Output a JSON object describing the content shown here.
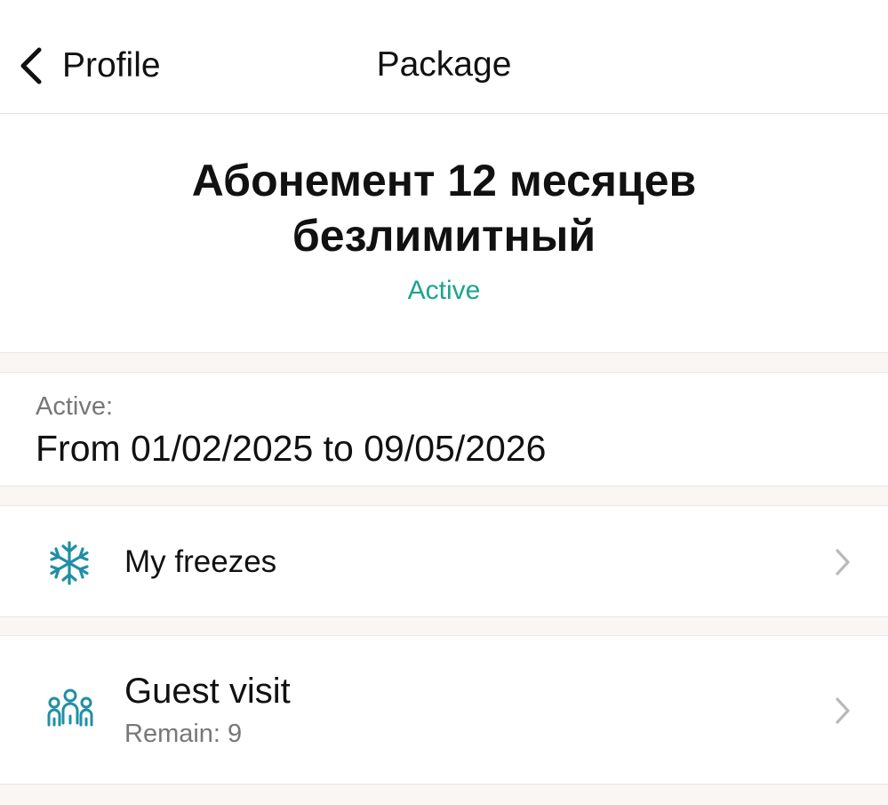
{
  "navbar": {
    "back_label": "Profile",
    "title": "Package"
  },
  "package": {
    "name": "Абонемент 12 месяцев безлимитный",
    "status": "Active"
  },
  "validity": {
    "label": "Active:",
    "range": "From 01/02/2025 to 09/05/2026"
  },
  "rows": {
    "freezes": {
      "icon": "snowflake-icon",
      "label": "My freezes"
    },
    "guest": {
      "icon": "people-group-icon",
      "label": "Guest visit",
      "sublabel": "Remain: 9"
    }
  },
  "colors": {
    "accent": "#1aa58c",
    "icon_teal": "#1f8fa5",
    "background": "#faf6f3"
  }
}
